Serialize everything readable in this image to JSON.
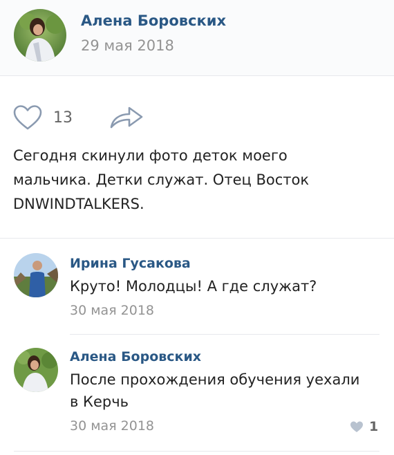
{
  "post": {
    "author": "Алена Боровских",
    "date": "29 мая 2018",
    "likes": "13",
    "text_lines": [
      "Сегодня скинули фото деток моего",
      "мальчика. Детки служат. Отец Восток",
      "DNWINDTALKERS."
    ]
  },
  "comments": [
    {
      "author": "Ирина Гусакова",
      "text_lines": [
        "Круто! Молодцы! А где служат?"
      ],
      "date": "30 мая 2018"
    },
    {
      "author": "Алена Боровских",
      "text_lines": [
        "После прохождения обучения уехали",
        "в Керчь"
      ],
      "date": "30 мая 2018",
      "likes": "1"
    }
  ],
  "icons": {
    "like": "heart-icon",
    "share": "share-arrow-icon",
    "comment_like": "heart-small-icon"
  },
  "colors": {
    "author_link": "#2a5885",
    "meta_gray": "#939393",
    "text": "#222222",
    "icon_gray": "#8a9ab0"
  }
}
